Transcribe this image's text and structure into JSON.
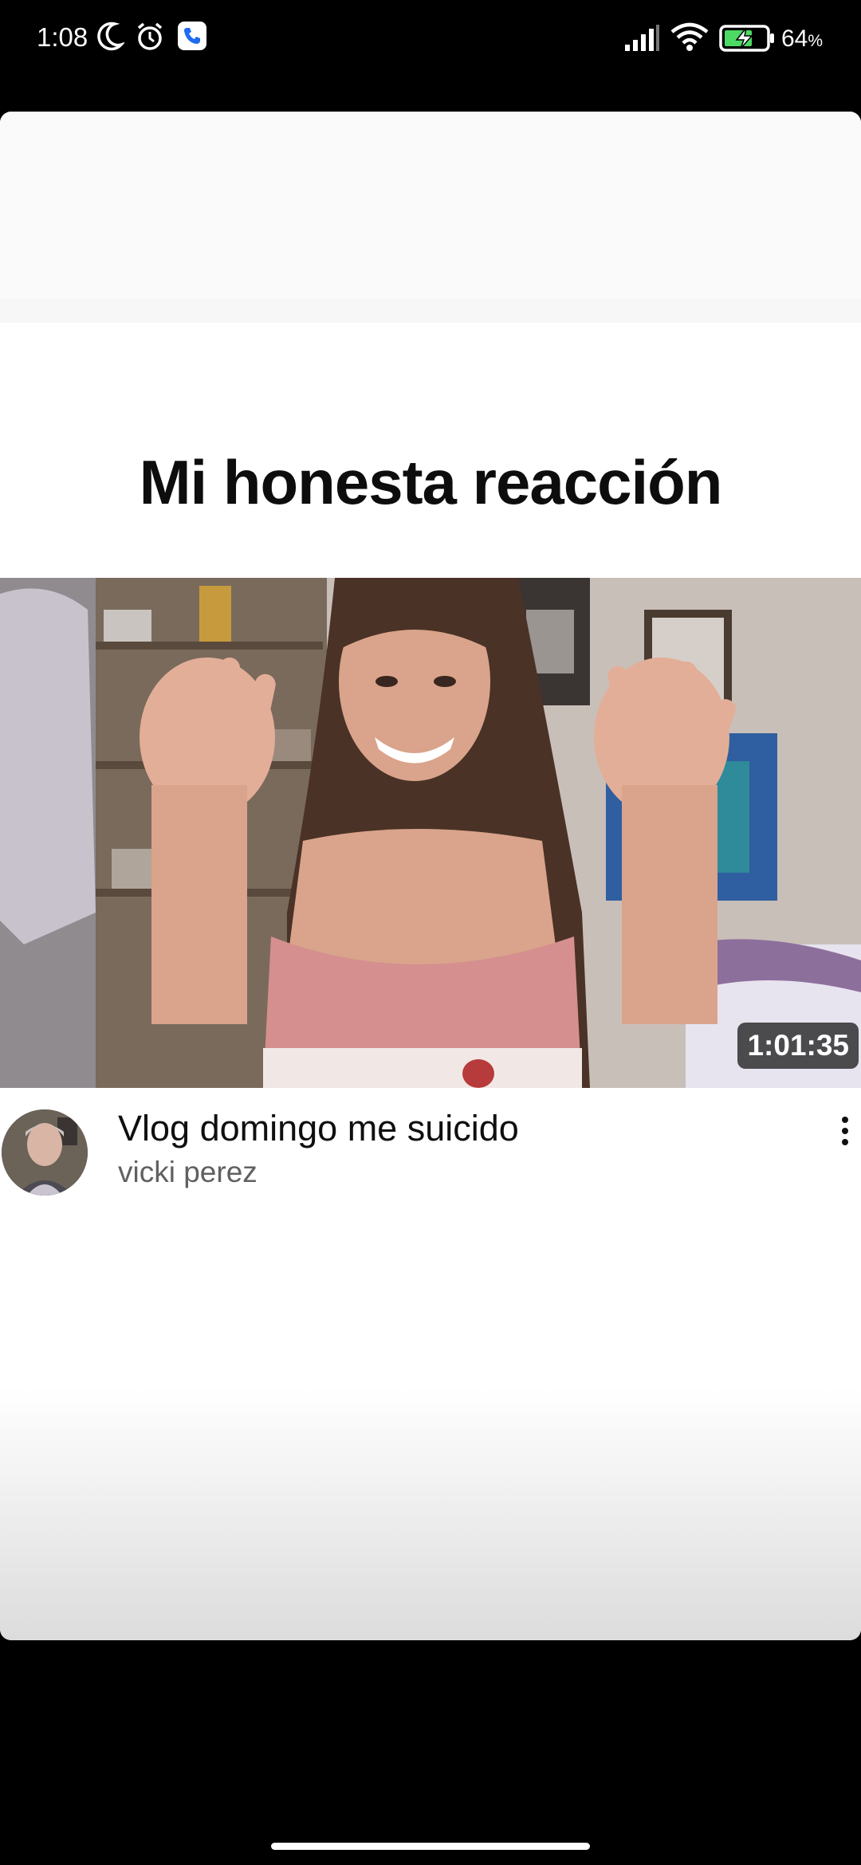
{
  "status_bar": {
    "time": "1:08",
    "battery_percent": "64",
    "battery_unit": "%",
    "icons": [
      "moon-icon",
      "alarm-icon",
      "phone-app-icon",
      "signal-icon",
      "wifi-icon",
      "battery-charging-icon"
    ]
  },
  "story": {
    "headline": "Mi honesta reacción"
  },
  "video": {
    "duration": "1:01:35",
    "title": "Vlog domingo me suicido",
    "channel": "vicki perez"
  },
  "colors": {
    "background": "#000000",
    "card": "#ffffff",
    "title_text": "#0f0f0f",
    "channel_text": "#606060"
  }
}
